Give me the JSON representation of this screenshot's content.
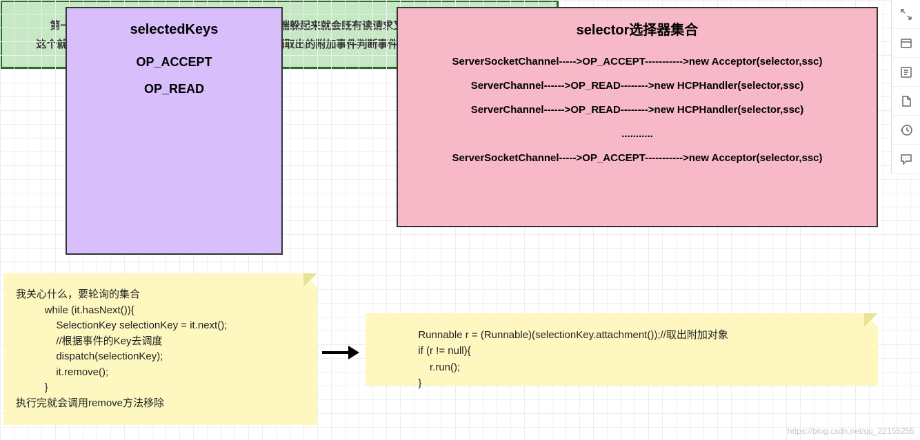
{
  "purple": {
    "title": "selectedKeys",
    "lines": [
      "OP_ACCEPT",
      "OP_READ"
    ]
  },
  "pink": {
    "title": "selector选择器集合",
    "lines": [
      "ServerSocketChannel----->OP_ACCEPT----------->new Acceptor(selector,ssc)",
      "ServerChannel------>OP_READ-------->new  HCPHandler(selector,ssc)",
      "ServerChannel------>OP_READ-------->new  HCPHandler(selector,ssc)",
      "...........",
      "ServerSocketChannel----->OP_ACCEPT----------->new Acceptor(selector,ssc)"
    ]
  },
  "green": {
    "line1": "第一次可能是只有一个accept请求，但是后面客户端躲起来就会既有读请求又有我们的accept请求，",
    "line2": "这个就是用一个集合，和绑定一个附加事件，通过我们取出的附加事件判断事件类型，然后执行不同的方法"
  },
  "yellow_left": {
    "text": "我关心什么，要轮询的集合\n          while (it.hasNext()){\n              SelectionKey selectionKey = it.next();\n              //根据事件的Key去调度\n              dispatch(selectionKey);\n              it.remove();\n          }\n执行完就会调用remove方法移除"
  },
  "yellow_right": {
    "text": "              Runnable r = (Runnable)(selectionKey.attachment());//取出附加对象\n              if (r != null){\n                  r.run();\n              }"
  },
  "toolbar": {
    "items": [
      "expand-icon",
      "layout-icon",
      "reader-icon",
      "page-icon",
      "history-icon",
      "comment-icon"
    ]
  },
  "watermark": "https://blog.csdn.net/qq_22155255"
}
